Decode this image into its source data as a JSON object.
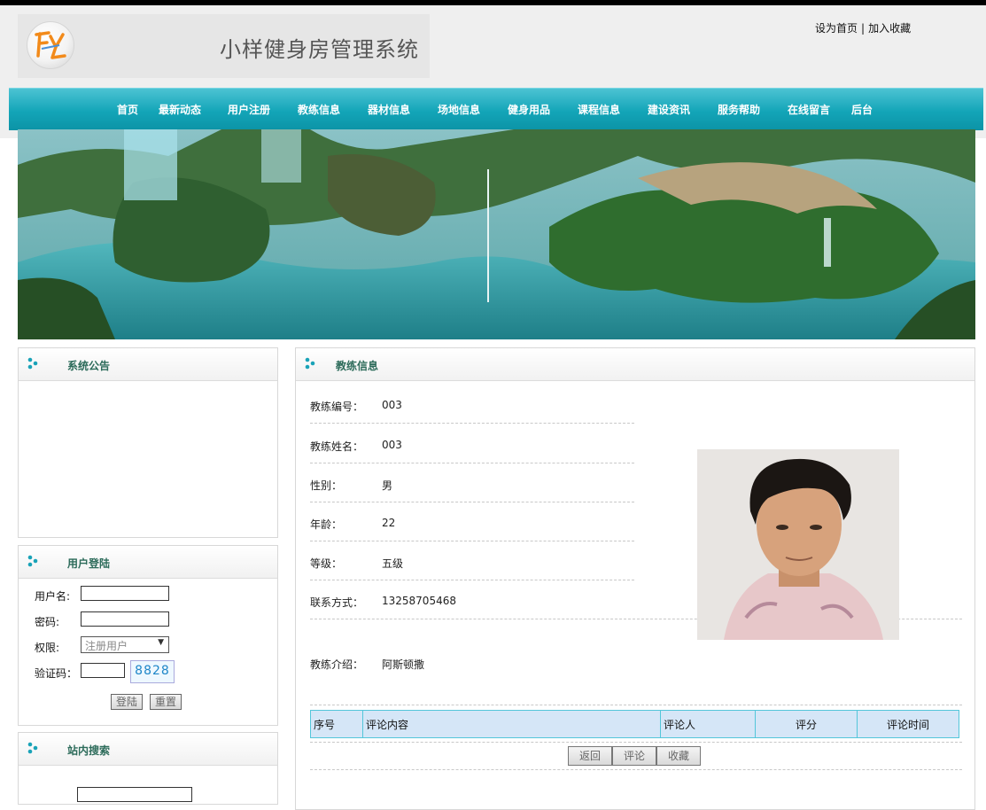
{
  "header": {
    "site_title": "小样健身房管理系统",
    "logo_text": "FY",
    "set_homepage": "设为首页",
    "separator": "|",
    "add_favorite": "加入收藏"
  },
  "nav": {
    "items": [
      "首页",
      "最新动态",
      "用户注册",
      "教练信息",
      "器材信息",
      "场地信息",
      "健身用品",
      "课程信息",
      "建设资讯",
      "服务帮助",
      "在线留言",
      "后台"
    ]
  },
  "sidebar": {
    "announcement_title": "系统公告",
    "login": {
      "title": "用户登陆",
      "username_label": "用户名:",
      "password_label": "密码:",
      "role_label": "权限:",
      "role_selected": "注册用户",
      "captcha_label": "验证码：",
      "captcha_value": "8828",
      "login_button": "登陆",
      "reset_button": "重置"
    },
    "search_title": "站内搜索"
  },
  "main": {
    "title": "教练信息",
    "fields": [
      {
        "label": "教练编号：",
        "value": "003"
      },
      {
        "label": "教练姓名：",
        "value": "003"
      },
      {
        "label": "性别：",
        "value": "男"
      },
      {
        "label": "年龄：",
        "value": "22"
      },
      {
        "label": "等级：",
        "value": "五级"
      },
      {
        "label": "联系方式：",
        "value": "13258705468"
      }
    ],
    "intro_label": "教练介绍：",
    "intro_value": "阿斯顿撒",
    "comment_headers": [
      "序号",
      "评论内容",
      "评论人",
      "评分",
      "评论时间"
    ],
    "buttons": {
      "back": "返回",
      "comment": "评论",
      "favorite": "收藏"
    }
  },
  "colors": {
    "nav_bg": "#13a5b8",
    "panel_title": "#2c6b5a",
    "table_header_bg": "#d5e6f7",
    "table_border": "#53c6da"
  }
}
